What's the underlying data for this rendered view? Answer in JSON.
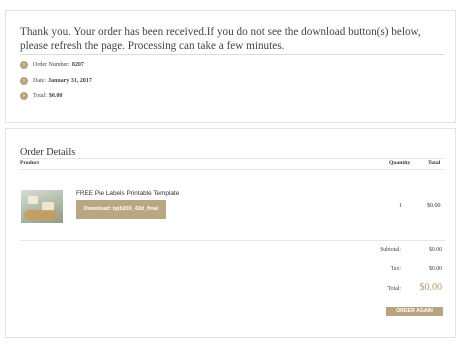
{
  "thanks": {
    "message": "Thank you. Your order has been received.If you do not see the download button(s) below, please refresh the page. Processing can take a few minutes.",
    "order_number_label": "Order Number:",
    "order_number": "8207",
    "date_label": "Date:",
    "date": "January 31, 2017",
    "total_label": "Total:",
    "total": "$0.00"
  },
  "order": {
    "title": "Order Details",
    "col_product": "Product",
    "col_quantity": "Quantity",
    "col_total": "Total",
    "item": {
      "name": "FREE Pie Labels Printable Template",
      "download_label": "Download: bpb203_43d_final",
      "quantity": "1",
      "total": "$0.00"
    },
    "subtotal_label": "Subtotal:",
    "subtotal": "$0.00",
    "tax_label": "Tax:",
    "tax": "$0.00",
    "total_label": "Total:",
    "total": "$0.00",
    "order_again_label": "ORDER AGAIN"
  },
  "colors": {
    "accent": "#b7a47f",
    "total_highlight": "#b49c6a"
  }
}
